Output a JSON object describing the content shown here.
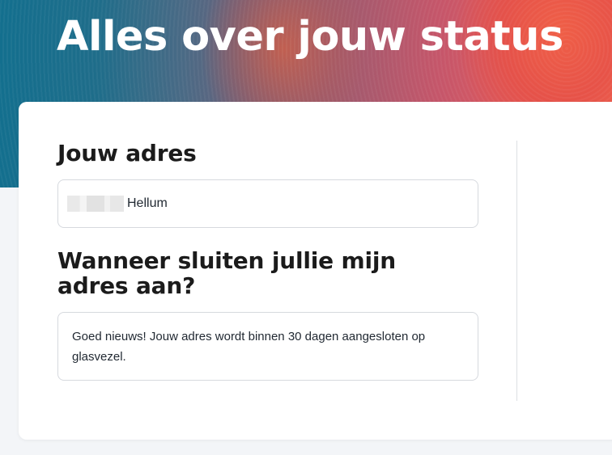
{
  "hero": {
    "title": "Alles over jouw status"
  },
  "address_section": {
    "heading": "Jouw adres",
    "city": "Hellum"
  },
  "connection_section": {
    "heading": "Wanneer sluiten jullie mijn adres aan?",
    "status_message": "Goed nieuws! Jouw adres wordt binnen 30 dagen aangesloten op glasvezel."
  },
  "colors": {
    "heading_text": "#1b1b1b",
    "hero_gradient_start": "#136f8e",
    "hero_gradient_end": "#ee6350",
    "card_background": "#ffffff",
    "page_background": "#f3f5f8"
  }
}
